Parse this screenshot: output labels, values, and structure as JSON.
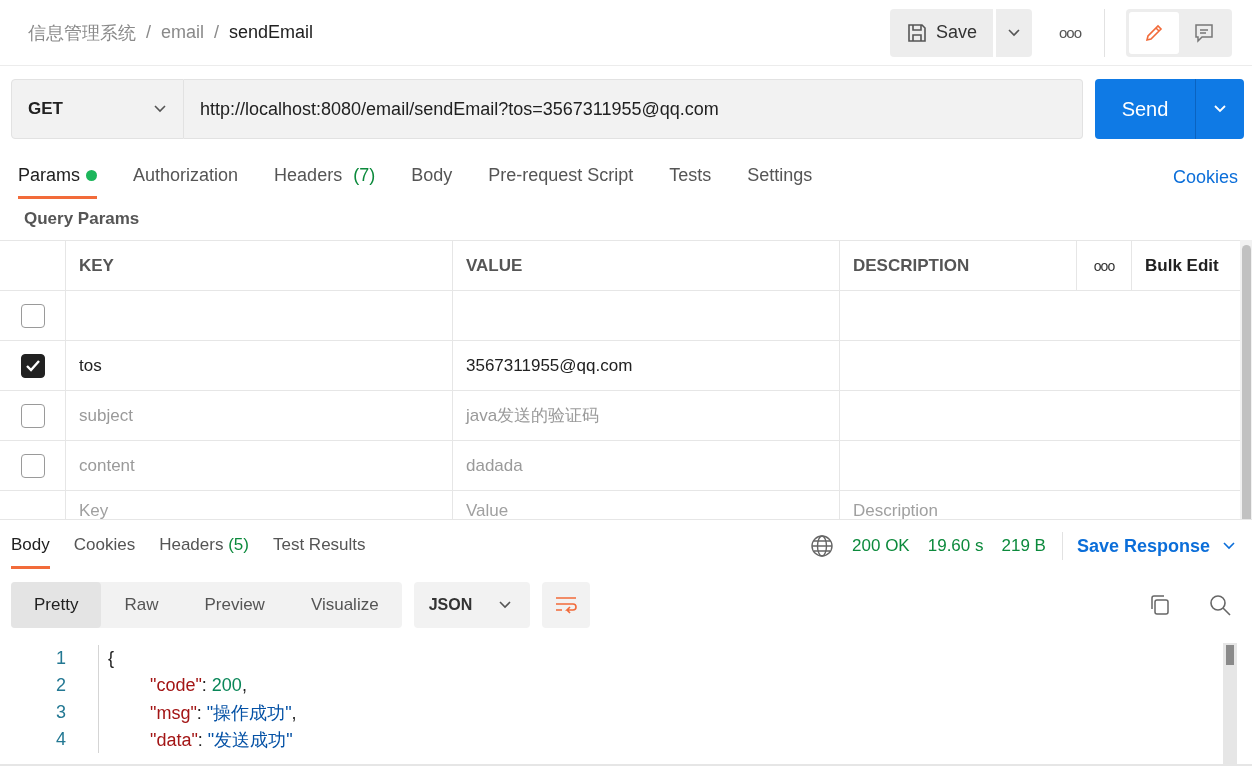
{
  "breadcrumb": [
    {
      "kind": "link",
      "text": "信息管理系统"
    },
    {
      "kind": "separator",
      "text": "/"
    },
    {
      "kind": "link",
      "text": "email"
    },
    {
      "kind": "separator",
      "text": "/"
    },
    {
      "kind": "current",
      "text": "sendEmail"
    }
  ],
  "toolbar": {
    "save": "Save",
    "more": "ooo",
    "modes": [
      {
        "kind": "edit",
        "selected": true
      },
      {
        "kind": "comments",
        "selected": false
      }
    ]
  },
  "request": {
    "method": "GET",
    "url": "http://localhost:8080/email/sendEmail?tos=3567311955@qq.com",
    "send": "Send"
  },
  "tabs": [
    {
      "label": "Params",
      "selected": true,
      "modified": true
    },
    {
      "label": "Authorization",
      "selected": false,
      "modified": false
    },
    {
      "label": "Headers",
      "count": "(7)",
      "selected": false,
      "modified": false
    },
    {
      "label": "Body",
      "selected": false,
      "modified": false
    },
    {
      "label": "Pre-request Script",
      "selected": false,
      "modified": false
    },
    {
      "label": "Tests",
      "selected": false,
      "modified": false
    },
    {
      "label": "Settings",
      "selected": false,
      "modified": false
    }
  ],
  "cookies_link": "Cookies",
  "query_params": {
    "title": "Query Params",
    "columns": [
      "KEY",
      "VALUE",
      "DESCRIPTION"
    ],
    "more": "ooo",
    "bulk_edit": "Bulk Edit",
    "rows": [
      {
        "checked": false
      },
      {
        "checked": true,
        "key": "tos",
        "value": "3567311955@qq.com"
      },
      {
        "checked": false,
        "key": "subject",
        "value": "java发送的验证码"
      },
      {
        "checked": false,
        "key": "content",
        "value": "dadada"
      }
    ],
    "new_row": {
      "key_placeholder": "Key",
      "value_placeholder": "Value",
      "description_placeholder": "Description"
    }
  },
  "response": {
    "tabs": [
      {
        "label": "Body",
        "selected": true
      },
      {
        "label": "Cookies",
        "selected": false
      },
      {
        "label": "Headers",
        "count": "(5)",
        "selected": false
      },
      {
        "label": "Test Results",
        "selected": false
      }
    ],
    "status": "200 OK",
    "time": "19.60 s",
    "size": "219 B",
    "save_response": "Save Response",
    "views": [
      {
        "label": "Pretty",
        "selected": true
      },
      {
        "label": "Raw",
        "selected": false
      },
      {
        "label": "Preview",
        "selected": false
      },
      {
        "label": "Visualize",
        "selected": false
      }
    ],
    "format": "JSON",
    "lines": [
      {
        "n": "1",
        "parts": [
          {
            "kind": "punct",
            "text": "{"
          }
        ],
        "children": [
          {
            "n": "2",
            "parts": [
              {
                "kind": "key",
                "text": "\"code\""
              },
              {
                "kind": "punct",
                "text": ": "
              },
              {
                "kind": "number",
                "text": "200"
              },
              {
                "kind": "punct",
                "text": ","
              }
            ]
          },
          {
            "n": "3",
            "parts": [
              {
                "kind": "key",
                "text": "\"msg\""
              },
              {
                "kind": "punct",
                "text": ": "
              },
              {
                "kind": "string",
                "text": "\"操作成功\""
              },
              {
                "kind": "punct",
                "text": ","
              }
            ]
          },
          {
            "n": "4",
            "parts": [
              {
                "kind": "key",
                "text": "\"data\""
              },
              {
                "kind": "punct",
                "text": ": "
              },
              {
                "kind": "string",
                "text": "\"发送成功\""
              }
            ]
          }
        ]
      }
    ]
  }
}
